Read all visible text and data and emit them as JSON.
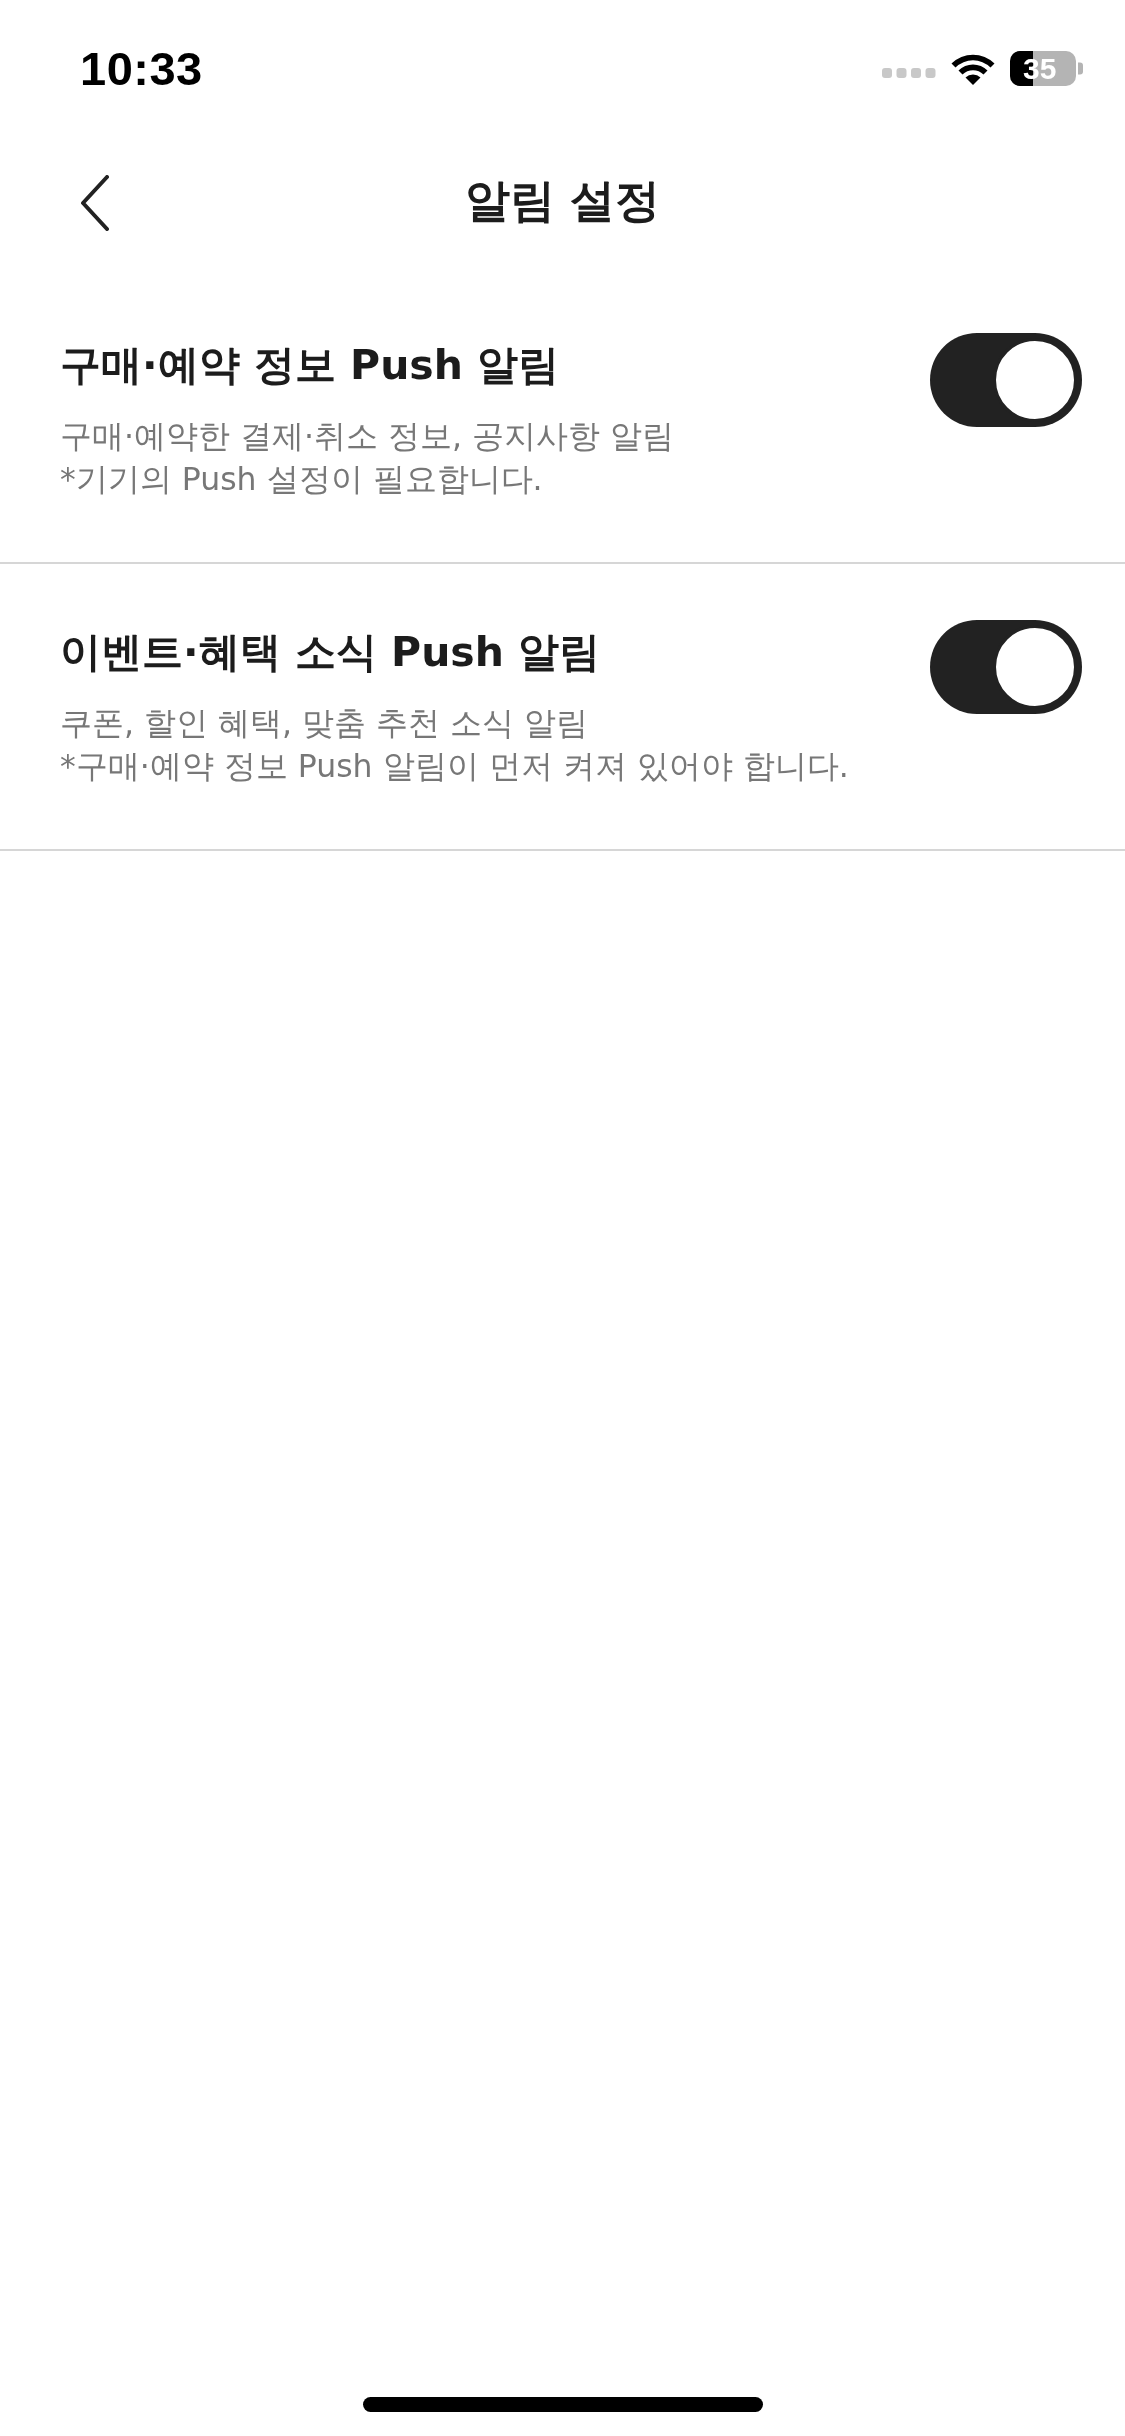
{
  "status_bar": {
    "time": "10:33",
    "battery_text": "35"
  },
  "header": {
    "title": "알림 설정"
  },
  "rows": [
    {
      "title": "구매·예약 정보 Push 알림",
      "lines": [
        "구매·예약한 결제·취소 정보, 공지사항 알림",
        "*기기의 Push 설정이 필요합니다."
      ],
      "on": true
    },
    {
      "title": "이벤트·혜택 소식 Push 알림",
      "lines": [
        "쿠폰, 할인 혜택, 맞춤 추천 소식 알림",
        "*구매·예약 정보 Push 알림이 먼저 켜져 있어야 합니다."
      ],
      "on": true
    }
  ]
}
